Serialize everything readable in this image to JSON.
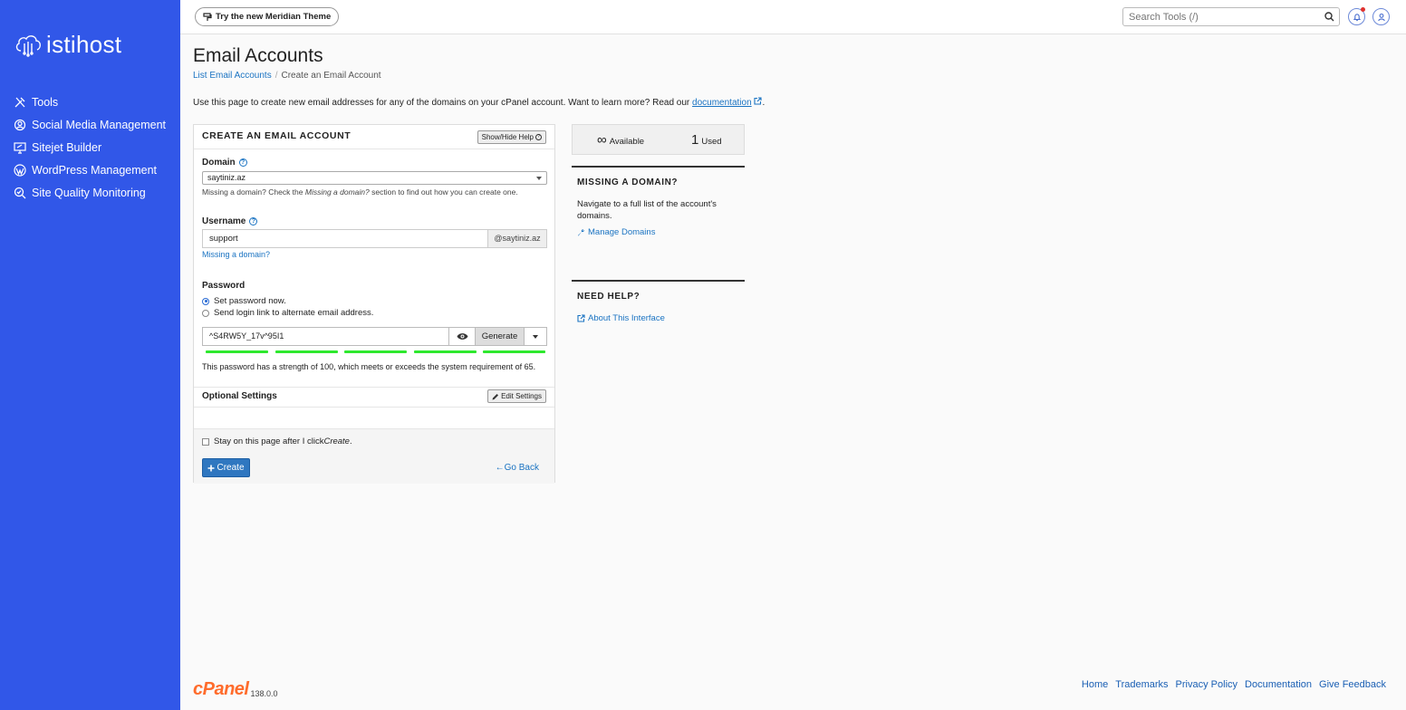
{
  "brand": {
    "name": "istihost"
  },
  "sidebar": {
    "items": [
      {
        "label": "Tools",
        "icon": "tools-icon"
      },
      {
        "label": "Social Media Management",
        "icon": "social-media-icon"
      },
      {
        "label": "Sitejet Builder",
        "icon": "sitejet-icon"
      },
      {
        "label": "WordPress Management",
        "icon": "wordpress-icon"
      },
      {
        "label": "Site Quality Monitoring",
        "icon": "site-quality-icon"
      }
    ]
  },
  "topbar": {
    "theme_label": "Try the new Meridian Theme",
    "search_placeholder": "Search Tools (/)"
  },
  "page": {
    "title": "Email Accounts",
    "breadcrumb": [
      "List Email Accounts",
      "Create an Email Account"
    ],
    "intro_text": "Use this page to create new email addresses for any of the domains on your cPanel account. Want to learn more? Read our",
    "intro_link": "documentation",
    "intro_end": "."
  },
  "form": {
    "heading": "CREATE AN EMAIL ACCOUNT",
    "help_label": "Show/Hide Help",
    "domain_label": "Domain",
    "domain_value": "saytiniz.az",
    "domain_hint_1": "Missing a domain? Check the ",
    "domain_hint_em": "Missing a domain?",
    "domain_hint_2": " section to find out how you can create one.",
    "username_label": "Username",
    "username_value": "support",
    "username_suffix": "@saytiniz.az",
    "missing_link": "Missing a domain?",
    "password_label": "Password",
    "radio_set": "Set password now.",
    "radio_send": "Send login link to alternate email address.",
    "password_value": "^S4RW5Y_17v^95I1",
    "generate_label": "Generate",
    "strength_text": "This password has a strength of 100, which meets or exceeds the system requirement of 65.",
    "strength_value": 100,
    "optional_label": "Optional Settings",
    "edit_settings_label": "Edit Settings",
    "stay_text": "Stay on this page after I click ",
    "stay_em": "Create",
    "stay_end": ".",
    "create_label": "Create",
    "goback_label": "Go Back"
  },
  "stats": {
    "available_value": "∞",
    "available_label": "Available",
    "used_value": "1",
    "used_label": "Used"
  },
  "missing_box": {
    "heading": "MISSING A DOMAIN?",
    "text": "Navigate to a full list of the account's domains.",
    "link": "Manage Domains"
  },
  "help_box": {
    "heading": "NEED HELP?",
    "link": "About This Interface"
  },
  "footer": {
    "logo": "cPanel",
    "version": "138.0.0",
    "links": [
      "Home",
      "Trademarks",
      "Privacy Policy",
      "Documentation",
      "Give Feedback"
    ]
  },
  "colors": {
    "sidebar_bg": "#3157e8",
    "primary_button": "#2f77c0",
    "strength_meter": "#2ee82e",
    "cpanel_orange": "#ff6c2c"
  }
}
